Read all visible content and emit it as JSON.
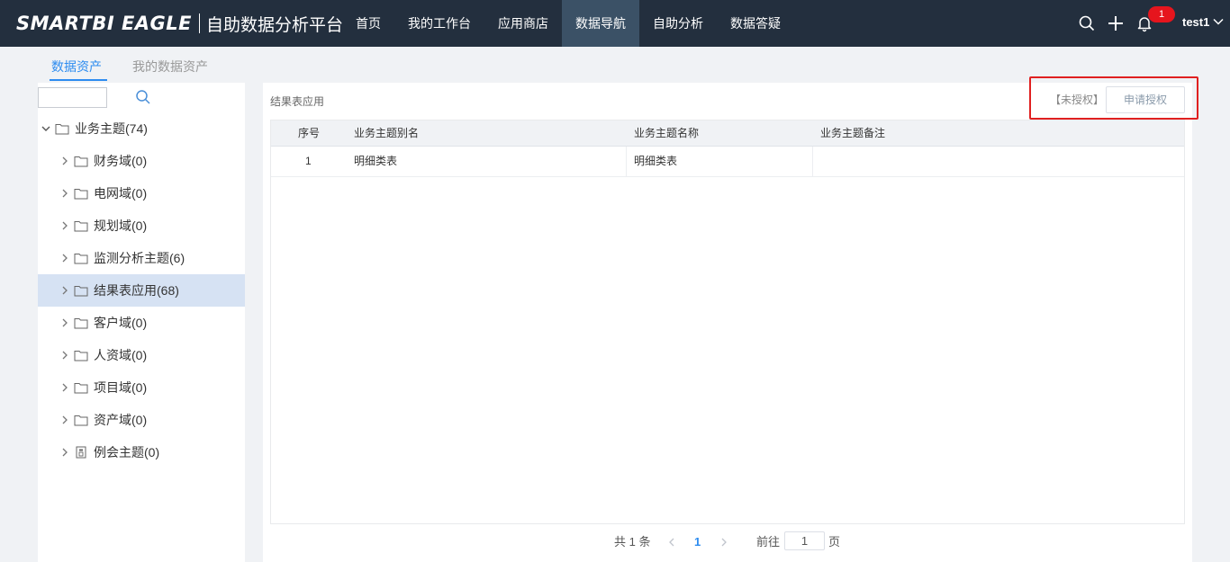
{
  "header": {
    "logo_main": "SMARTBI EAGLE",
    "logo_sub": "自助数据分析平台",
    "nav": [
      {
        "label": "首页"
      },
      {
        "label": "我的工作台"
      },
      {
        "label": "应用商店"
      },
      {
        "label": "数据导航",
        "active": true
      },
      {
        "label": "自助分析"
      },
      {
        "label": "数据答疑"
      }
    ],
    "notification_count": "1",
    "username": "test1",
    "icons": [
      "search-icon",
      "plus-icon",
      "bell-icon",
      "chevron-down-icon"
    ]
  },
  "subtabs": {
    "active": "数据资产",
    "inactive": "我的数据资产"
  },
  "sidebar": {
    "search_value": "",
    "root": {
      "label": "业务主题(74)",
      "expanded": true
    },
    "items": [
      {
        "label": "财务域(0)"
      },
      {
        "label": "电网域(0)"
      },
      {
        "label": "规划域(0)"
      },
      {
        "label": "监测分析主题(6)"
      },
      {
        "label": "结果表应用(68)",
        "selected": true
      },
      {
        "label": "客户域(0)"
      },
      {
        "label": "人资域(0)"
      },
      {
        "label": "项目域(0)"
      },
      {
        "label": "资产域(0)"
      },
      {
        "label": "例会主题(0)",
        "icon": "document-icon"
      }
    ]
  },
  "main": {
    "breadcrumb": "结果表应用",
    "unauth_label": "【未授权】",
    "apply_button": "申请授权",
    "table": {
      "headers": [
        "序号",
        "业务主题别名",
        "业务主题名称",
        "业务主题备注"
      ],
      "rows": [
        [
          "1",
          "明细类表",
          "明细类表",
          ""
        ]
      ]
    },
    "pagination": {
      "total_text": "共 1 条",
      "current_page": "1",
      "goto_label": "前往",
      "goto_value": "1",
      "page_suffix": "页"
    }
  },
  "colors": {
    "topbar_bg": "#232f3e",
    "nav_active_bg": "#3b5166",
    "accent": "#2d8cf0",
    "badge": "#e6151d",
    "selected_row": "#d6e2f3",
    "highlight_border": "#e02020"
  }
}
